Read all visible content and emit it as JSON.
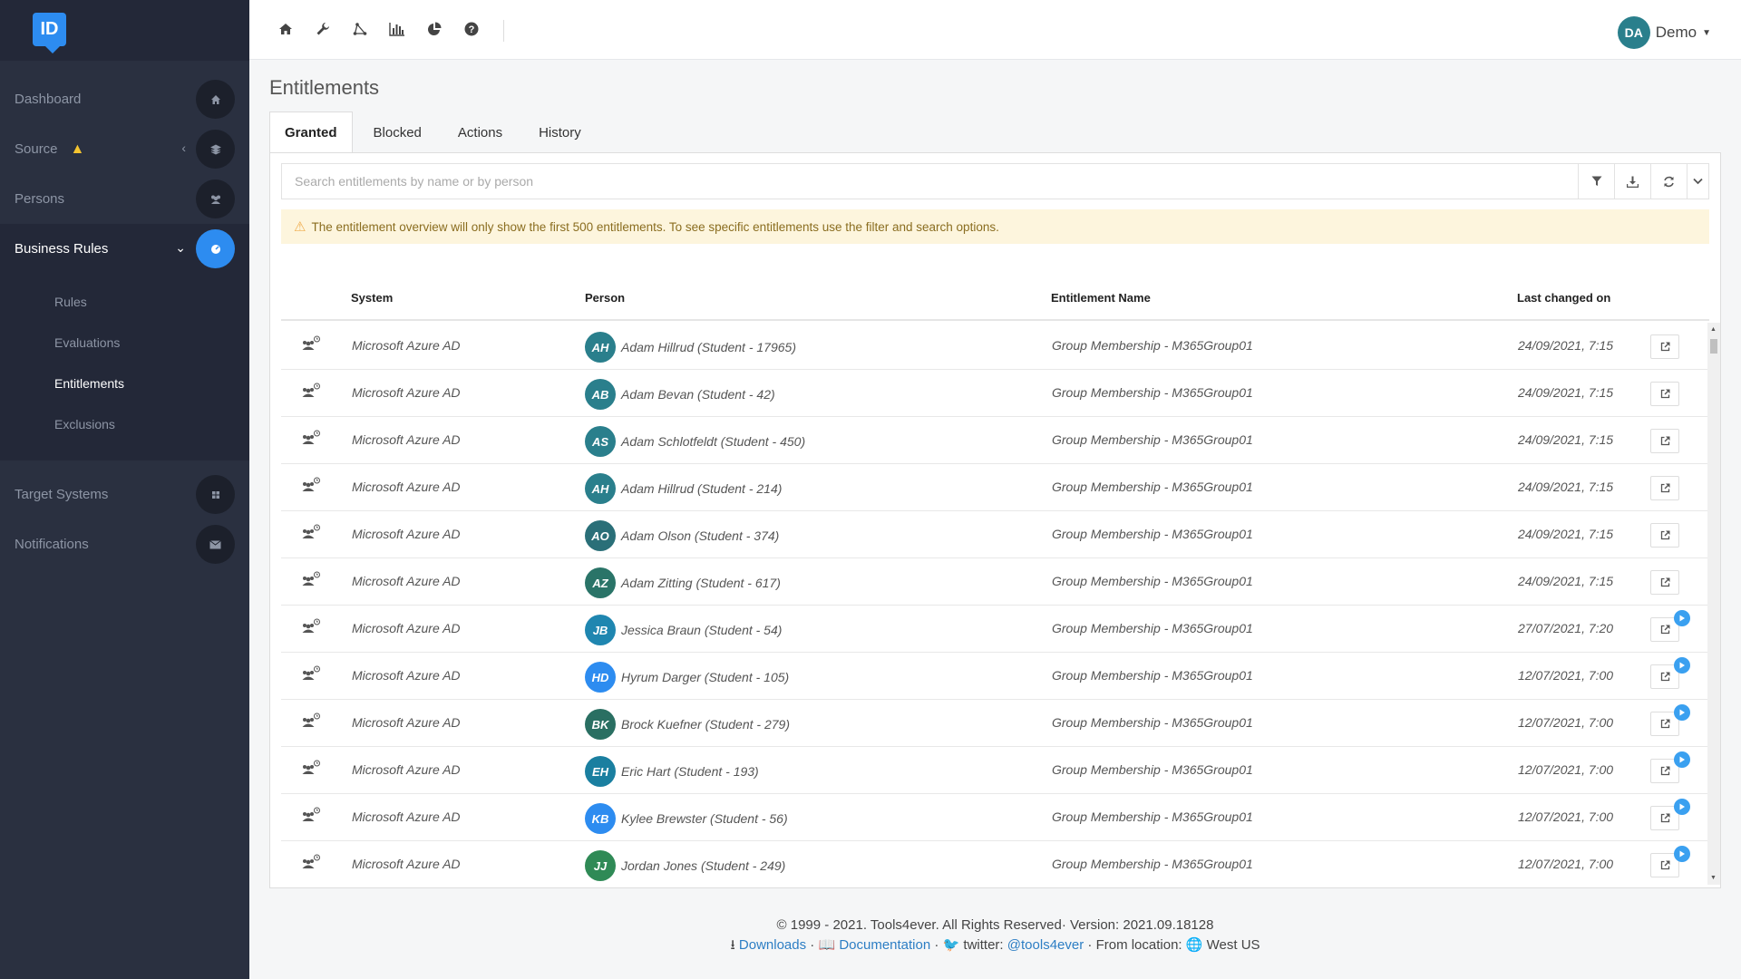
{
  "app": {
    "logo_text": "ID"
  },
  "sidebar": {
    "items": [
      {
        "label": "Dashboard",
        "icon": "home-icon"
      },
      {
        "label": "Source",
        "icon": "stack-icon",
        "warning": true
      },
      {
        "label": "Persons",
        "icon": "users-icon"
      },
      {
        "label": "Business Rules",
        "icon": "gauge-icon",
        "active": true
      }
    ],
    "sub_items": [
      {
        "label": "Rules"
      },
      {
        "label": "Evaluations"
      },
      {
        "label": "Entitlements",
        "active": true
      },
      {
        "label": "Exclusions"
      }
    ],
    "items_bottom": [
      {
        "label": "Target Systems",
        "icon": "grid-icon"
      },
      {
        "label": "Notifications",
        "icon": "envelope-icon"
      }
    ]
  },
  "topbar": {
    "icons": [
      "home-icon",
      "wrench-icon",
      "network-icon",
      "bar-chart-icon",
      "pie-chart-icon",
      "help-icon"
    ],
    "user": {
      "initials": "DA",
      "name": "Demo"
    }
  },
  "page": {
    "title": "Entitlements",
    "tabs": [
      {
        "label": "Granted",
        "active": true
      },
      {
        "label": "Blocked"
      },
      {
        "label": "Actions"
      },
      {
        "label": "History"
      }
    ],
    "search": {
      "placeholder": "Search entitlements by name or by person",
      "value": ""
    },
    "alert": "The entitlement overview will only show the first 500 entitlements. To see specific entitlements use the filter and search options."
  },
  "table": {
    "columns": [
      "System",
      "Person",
      "Entitlement Name",
      "Last changed on"
    ],
    "rows": [
      {
        "system": "Microsoft Azure AD",
        "initials": "AH",
        "avatar_color": "#2a7f8c",
        "person": "Adam Hillrud (Student - 17965)",
        "entitlement": "Group Membership - M365Group01",
        "date": "24/09/2021, 7:15",
        "badge": false
      },
      {
        "system": "Microsoft Azure AD",
        "initials": "AB",
        "avatar_color": "#2a7f8c",
        "person": "Adam Bevan (Student - 42)",
        "entitlement": "Group Membership - M365Group01",
        "date": "24/09/2021, 7:15",
        "badge": false
      },
      {
        "system": "Microsoft Azure AD",
        "initials": "AS",
        "avatar_color": "#2a7f8c",
        "person": "Adam Schlotfeldt (Student - 450)",
        "entitlement": "Group Membership - M365Group01",
        "date": "24/09/2021, 7:15",
        "badge": false
      },
      {
        "system": "Microsoft Azure AD",
        "initials": "AH",
        "avatar_color": "#2a7f8c",
        "person": "Adam Hillrud (Student - 214)",
        "entitlement": "Group Membership - M365Group01",
        "date": "24/09/2021, 7:15",
        "badge": false
      },
      {
        "system": "Microsoft Azure AD",
        "initials": "AO",
        "avatar_color": "#2a6f78",
        "person": "Adam Olson (Student - 374)",
        "entitlement": "Group Membership - M365Group01",
        "date": "24/09/2021, 7:15",
        "badge": false
      },
      {
        "system": "Microsoft Azure AD",
        "initials": "AZ",
        "avatar_color": "#2a7468",
        "person": "Adam Zitting (Student - 617)",
        "entitlement": "Group Membership - M365Group01",
        "date": "24/09/2021, 7:15",
        "badge": false
      },
      {
        "system": "Microsoft Azure AD",
        "initials": "JB",
        "avatar_color": "#1f86b0",
        "person": "Jessica Braun (Student - 54)",
        "entitlement": "Group Membership - M365Group01",
        "date": "27/07/2021, 7:20",
        "badge": true
      },
      {
        "system": "Microsoft Azure AD",
        "initials": "HD",
        "avatar_color": "#2d8cf0",
        "person": "Hyrum Darger (Student - 105)",
        "entitlement": "Group Membership - M365Group01",
        "date": "12/07/2021, 7:00",
        "badge": true
      },
      {
        "system": "Microsoft Azure AD",
        "initials": "BK",
        "avatar_color": "#2a6f62",
        "person": "Brock Kuefner (Student - 279)",
        "entitlement": "Group Membership - M365Group01",
        "date": "12/07/2021, 7:00",
        "badge": true
      },
      {
        "system": "Microsoft Azure AD",
        "initials": "EH",
        "avatar_color": "#1a7fa0",
        "person": "Eric Hart (Student - 193)",
        "entitlement": "Group Membership - M365Group01",
        "date": "12/07/2021, 7:00",
        "badge": true
      },
      {
        "system": "Microsoft Azure AD",
        "initials": "KB",
        "avatar_color": "#2d8cf0",
        "person": "Kylee Brewster (Student - 56)",
        "entitlement": "Group Membership - M365Group01",
        "date": "12/07/2021, 7:00",
        "badge": true
      },
      {
        "system": "Microsoft Azure AD",
        "initials": "JJ",
        "avatar_color": "#2f8a56",
        "person": "Jordan Jones (Student - 249)",
        "entitlement": "Group Membership - M365Group01",
        "date": "12/07/2021, 7:00",
        "badge": true
      }
    ]
  },
  "footer": {
    "copyright": "© 1999 - 2021. Tools4ever. All Rights Reserved· Version: 2021.09.18128",
    "downloads": "Downloads",
    "documentation": "Documentation",
    "twitter_label": "twitter:",
    "twitter_handle": "@tools4ever",
    "location_label": "From location:",
    "location": "West US"
  }
}
